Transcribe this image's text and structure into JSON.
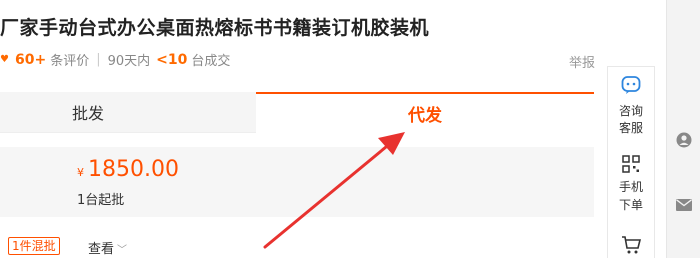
{
  "product": {
    "title": "厂家手动台式办公桌面热熔标书书籍装订机胶装机",
    "review_count": "60+",
    "review_label": "条评价",
    "period_label": "90天内",
    "deal_count": "<10",
    "deal_label": "台成交",
    "report_label": "举报"
  },
  "tabs": {
    "wholesale_label": "批发",
    "dropship_label": "代发"
  },
  "price": {
    "currency": "¥",
    "value": "1850.00",
    "moq": "1台起批"
  },
  "options": {
    "mixed_badge": "1件混批",
    "view_label": "查看"
  },
  "sidebar": {
    "consult_line1": "咨询",
    "consult_line2": "客服",
    "mobile_line1": "手机",
    "mobile_line2": "下单"
  },
  "colors": {
    "accent": "#ff5000",
    "annotation_arrow": "#e8322f"
  }
}
